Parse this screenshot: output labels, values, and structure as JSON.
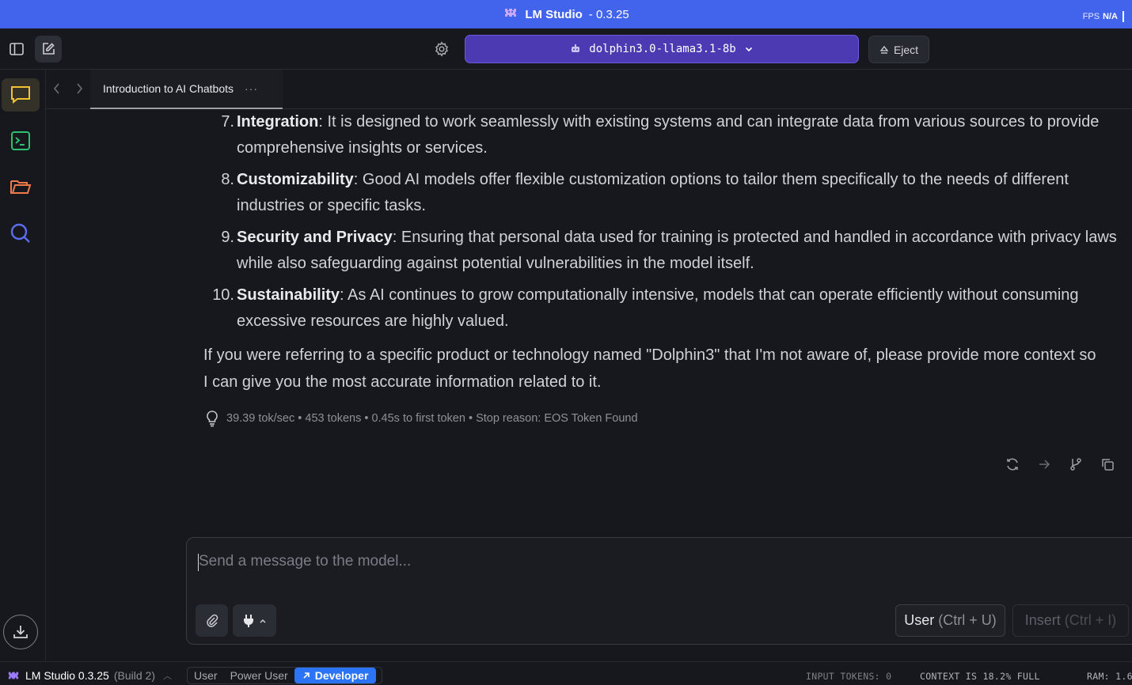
{
  "app": {
    "name": "LM Studio",
    "version": "- 0.3.25",
    "fps_label": "FPS",
    "fps_value": "N/A",
    "brand_color": "#4263eb"
  },
  "toolbar": {
    "model_name": "dolphin3.0-llama3.1-8b",
    "eject_label": "Eject"
  },
  "sidebar": {
    "items": [
      {
        "name": "chat",
        "icon": "chat-bubble-icon",
        "active": true
      },
      {
        "name": "developer",
        "icon": "terminal-icon",
        "active": false
      },
      {
        "name": "my-models",
        "icon": "folder-icon",
        "active": false
      },
      {
        "name": "discover",
        "icon": "search-icon",
        "active": false
      }
    ]
  },
  "tabs": [
    {
      "label": "Introduction to AI Chatbots",
      "more": "···"
    }
  ],
  "message": {
    "items": [
      {
        "num": "7.",
        "title": "Integration",
        "text": ": It is designed to work seamlessly with existing systems and can integrate data from various sources to provide",
        "cont": "comprehensive insights or services."
      },
      {
        "num": "8.",
        "title": "Customizability",
        "text": ": Good AI models offer flexible customization options to tailor them specifically to the needs of different",
        "cont": "industries or specific tasks."
      },
      {
        "num": "9.",
        "title": "Security and Privacy",
        "text": ": Ensuring that personal data used for training is protected and handled in accordance with privacy laws",
        "cont": "while also safeguarding against potential vulnerabilities in the model itself."
      },
      {
        "num": "10.",
        "title": "Sustainability",
        "text": ": As AI continues to grow computationally intensive, models that can operate efficiently without consuming",
        "cont": "excessive resources are highly valued."
      }
    ],
    "closing_line1": "If you were referring to a specific product or technology named \"Dolphin3\" that I'm not aware of, please provide more context so",
    "closing_line2": "I can give you the most accurate information related to it.",
    "stats": "39.39 tok/sec • 453 tokens • 0.45s to first token • Stop reason: EOS Token Found"
  },
  "composer": {
    "placeholder": "Send a message to the model...",
    "role_label": "User",
    "role_shortcut": "(Ctrl + U)",
    "insert_label": "Insert",
    "insert_shortcut": "(Ctrl + I)"
  },
  "statusbar": {
    "app_label": "LM Studio 0.3.25",
    "build": "(Build 2)",
    "modes": [
      "User",
      "Power User",
      "Developer"
    ],
    "active_mode": "Developer",
    "input_tokens": "INPUT TOKENS:  0",
    "context": "CONTEXT IS 18.2% FULL",
    "ram": "RAM: 1.6"
  }
}
